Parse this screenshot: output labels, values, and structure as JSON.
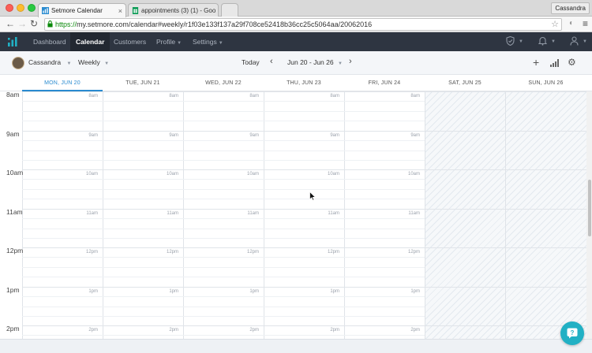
{
  "browser": {
    "tabs": [
      {
        "title": "Setmore Calendar",
        "active": true
      },
      {
        "title": "appointments (3) (1) - Goo",
        "active": false
      },
      {
        "title": "",
        "active": false
      }
    ],
    "user": "Cassandra",
    "url_scheme": "https://",
    "url_rest": "my.setmore.com/calendar#weekly/r1f03e133f137a29f708ce52418b36cc25c5064aa/20062016"
  },
  "appnav": {
    "items": [
      {
        "label": "Dashboard",
        "active": false,
        "dropdown": false
      },
      {
        "label": "Calendar",
        "active": true,
        "dropdown": false
      },
      {
        "label": "Customers",
        "active": false,
        "dropdown": false
      },
      {
        "label": "Profile",
        "active": false,
        "dropdown": true
      },
      {
        "label": "Settings",
        "active": false,
        "dropdown": true
      }
    ],
    "right_icons": [
      "shield-icon",
      "bell-icon",
      "user-icon"
    ]
  },
  "toolbar": {
    "staff": "Cassandra",
    "view": "Weekly",
    "today_label": "Today",
    "range": "Jun 20 - Jun 26"
  },
  "days": [
    {
      "label": "MON, JUN 20",
      "today": true,
      "weekend": false
    },
    {
      "label": "TUE, JUN 21",
      "today": false,
      "weekend": false
    },
    {
      "label": "WED, JUN 22",
      "today": false,
      "weekend": false
    },
    {
      "label": "THU, JUN 23",
      "today": false,
      "weekend": false
    },
    {
      "label": "FRI, JUN 24",
      "today": false,
      "weekend": false
    },
    {
      "label": "SAT, JUN 25",
      "today": false,
      "weekend": true
    },
    {
      "label": "SUN, JUN 26",
      "today": false,
      "weekend": true
    }
  ],
  "hours": [
    "8am",
    "9am",
    "10am",
    "11am",
    "12pm",
    "1pm",
    "2pm"
  ],
  "colors": {
    "navbar": "#2e3541",
    "accent": "#2a8bd0",
    "help": "#21b0c4"
  }
}
